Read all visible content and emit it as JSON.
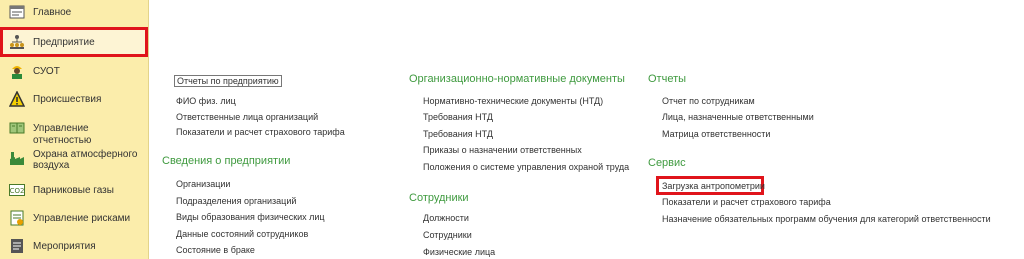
{
  "sidebar": {
    "items": [
      {
        "label": "Главное",
        "icon": "home-icon"
      },
      {
        "label": "Предприятие",
        "icon": "org-structure-icon"
      },
      {
        "label": "СУОТ",
        "icon": "worker-icon"
      },
      {
        "label": "Происшествия",
        "icon": "warning-icon"
      },
      {
        "label": "Управление отчетностью",
        "icon": "book-icon"
      },
      {
        "label_line1": "Охрана атмосферного",
        "label_line2": "воздуха",
        "icon": "factory-icon"
      },
      {
        "label": "Парниковые газы",
        "icon": "co2-icon"
      },
      {
        "label": "Управление рисками",
        "icon": "risk-icon"
      },
      {
        "label": "Мероприятия",
        "icon": "list-icon"
      }
    ]
  },
  "col1": {
    "links": [
      "Отчеты по предприятию",
      "ФИО физ. лиц",
      "Ответственные лица организаций",
      "Показатели и расчет страхового тарифа"
    ],
    "section2": {
      "title": "Сведения о предприятии",
      "links": [
        "Организации",
        "Подразделения организаций",
        "Виды образования физических лиц",
        "Данные состояний сотрудников",
        "Состояние в браке"
      ]
    }
  },
  "col2": {
    "section1": {
      "title": "Организационно-нормативные документы",
      "links": [
        "Нормативно-технические документы (НТД)",
        "Требования НТД",
        "Требования НТД",
        "Приказы о назначении ответственных",
        "Положения о системе управления охраной труда"
      ]
    },
    "section2": {
      "title": "Сотрудники",
      "links": [
        "Должности",
        "Сотрудники",
        "Физические лица"
      ]
    }
  },
  "col3": {
    "section1": {
      "title": "Отчеты",
      "links": [
        "Отчет по сотрудникам",
        "Лица, назначенные ответственными",
        "Матрица ответственности"
      ]
    },
    "section2": {
      "title": "Сервис",
      "links": [
        "Загрузка антропометрии",
        "Показатели и расчет страхового тарифа",
        "Назначение обязательных программ обучения для категорий ответственности"
      ]
    }
  },
  "colors": {
    "sidebar_bg": "#fbedab",
    "section_title": "#3f9a3f",
    "highlight": "#e0141b"
  }
}
